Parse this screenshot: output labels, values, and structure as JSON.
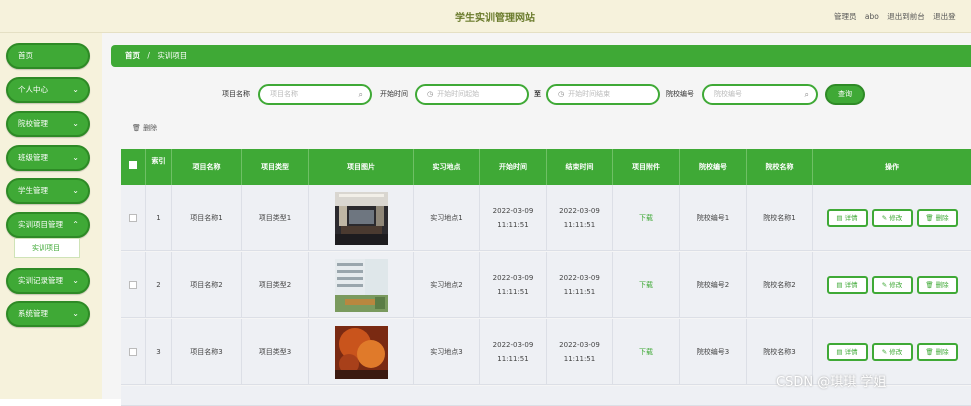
{
  "header": {
    "title": "学生实训管理网站",
    "role_label": "管理员",
    "username": "abo",
    "back_link": "退出到前台",
    "logout_link": "退出登"
  },
  "sidebar": {
    "items": [
      {
        "label": "首页",
        "chevron": ""
      },
      {
        "label": "个人中心",
        "chevron": "⌄"
      },
      {
        "label": "院校管理",
        "chevron": "⌄"
      },
      {
        "label": "班级管理",
        "chevron": "⌄"
      },
      {
        "label": "学生管理",
        "chevron": "⌄"
      },
      {
        "label": "实训项目管理",
        "chevron": "⌃"
      },
      {
        "label": "实训记录管理",
        "chevron": "⌄"
      },
      {
        "label": "系统管理",
        "chevron": "⌄"
      }
    ],
    "submenu_item": "实训项目"
  },
  "breadcrumb": {
    "home": "首页",
    "separator": "/",
    "current": "实训项目"
  },
  "search": {
    "project_name_label": "项目名称",
    "project_name_placeholder": "项目名称",
    "start_time_label": "开始时间",
    "start_from_placeholder": "开始时间起始",
    "to_label": "至",
    "start_to_placeholder": "开始时间结束",
    "school_code_label": "院校编号",
    "school_code_placeholder": "院校编号",
    "search_button": "查询"
  },
  "toolbar": {
    "delete_label": "删除"
  },
  "table": {
    "headers": [
      "",
      "索引",
      "项目名称",
      "项目类型",
      "项目图片",
      "实习地点",
      "开始时间",
      "结束时间",
      "项目附件",
      "院校编号",
      "院校名称",
      "操作"
    ],
    "rows": [
      {
        "index": "1",
        "name": "项目名称1",
        "type": "项目类型1",
        "location": "实习地点1",
        "start": "2022-03-09 11:11:51",
        "end": "2022-03-09 11:11:51",
        "attachment": "下载",
        "school_code": "院校编号1",
        "school_name": "院校名称1"
      },
      {
        "index": "2",
        "name": "项目名称2",
        "type": "项目类型2",
        "location": "实习地点2",
        "start": "2022-03-09 11:11:51",
        "end": "2022-03-09 11:11:51",
        "attachment": "下载",
        "school_code": "院校编号2",
        "school_name": "院校名称2"
      },
      {
        "index": "3",
        "name": "项目名称3",
        "type": "项目类型3",
        "location": "实习地点3",
        "start": "2022-03-09 11:11:51",
        "end": "2022-03-09 11:11:51",
        "attachment": "下载",
        "school_code": "院校编号3",
        "school_name": "院校名称3"
      }
    ],
    "actions": {
      "detail": "详情",
      "edit": "修改",
      "delete": "删除"
    }
  },
  "watermark": "CSDN @琪琪 学姐",
  "colors": {
    "accent": "#3fa936",
    "sidebar_bg": "#f6f2dc",
    "main_bg": "#f5f5f5"
  }
}
